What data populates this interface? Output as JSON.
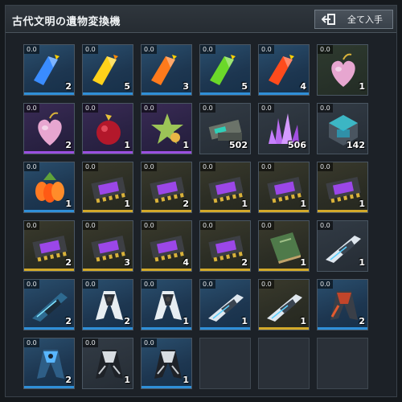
{
  "window": {
    "title": "古代文明の遺物変換機",
    "collect_all_label": "全て入手",
    "collect_icon": "exit-arrow-icon"
  },
  "colors": {
    "common": "#2f8fd8",
    "rare": "#9a4fe0",
    "legendary": "#d2a92a"
  },
  "slots": [
    {
      "time": "0.0",
      "qty": "2",
      "item": "blue-crystal",
      "rarity": "blue"
    },
    {
      "time": "0.0",
      "qty": "5",
      "item": "yellow-crystal",
      "rarity": "blue"
    },
    {
      "time": "0.0",
      "qty": "3",
      "item": "orange-crystal",
      "rarity": "blue"
    },
    {
      "time": "0.0",
      "qty": "5",
      "item": "green-crystal",
      "rarity": "blue"
    },
    {
      "time": "0.0",
      "qty": "4",
      "item": "red-crystal",
      "rarity": "blue"
    },
    {
      "time": "0.0",
      "qty": "1",
      "item": "pink-heart-fruit",
      "rarity": "green"
    },
    {
      "time": "0.0",
      "qty": "2",
      "item": "pink-heart-fruit",
      "rarity": "purple"
    },
    {
      "time": "0.0",
      "qty": "1",
      "item": "red-berry",
      "rarity": "purple"
    },
    {
      "time": "0.0",
      "qty": "1",
      "item": "green-star-fruit",
      "rarity": "purple"
    },
    {
      "time": "0.0",
      "qty": "502",
      "item": "mech-parts",
      "rarity": "dark"
    },
    {
      "time": "0.0",
      "qty": "506",
      "item": "purple-crystal-cluster",
      "rarity": "dark"
    },
    {
      "time": "0.0",
      "qty": "142",
      "item": "cyan-cube",
      "rarity": "dark"
    },
    {
      "time": "0.0",
      "qty": "1",
      "item": "orange-flower",
      "rarity": "blue"
    },
    {
      "time": "0.0",
      "qty": "1",
      "item": "chip",
      "rarity": "gold"
    },
    {
      "time": "0.0",
      "qty": "2",
      "item": "chip",
      "rarity": "gold"
    },
    {
      "time": "0.0",
      "qty": "1",
      "item": "chip",
      "rarity": "gold"
    },
    {
      "time": "0.0",
      "qty": "1",
      "item": "chip",
      "rarity": "gold"
    },
    {
      "time": "0.0",
      "qty": "1",
      "item": "chip",
      "rarity": "gold"
    },
    {
      "time": "0.0",
      "qty": "2",
      "item": "chip",
      "rarity": "gold"
    },
    {
      "time": "0.0",
      "qty": "3",
      "item": "chip",
      "rarity": "gold"
    },
    {
      "time": "0.0",
      "qty": "4",
      "item": "chip",
      "rarity": "gold"
    },
    {
      "time": "0.0",
      "qty": "2",
      "item": "chip",
      "rarity": "gold"
    },
    {
      "time": "0.0",
      "qty": "1",
      "item": "green-book",
      "rarity": "gold"
    },
    {
      "time": "0.0",
      "qty": "1",
      "item": "white-weapon",
      "rarity": "dark"
    },
    {
      "time": "0.0",
      "qty": "2",
      "item": "blue-weapon",
      "rarity": "blue"
    },
    {
      "time": "0.0",
      "qty": "2",
      "item": "white-armor",
      "rarity": "blue"
    },
    {
      "time": "0.0",
      "qty": "1",
      "item": "white-armor",
      "rarity": "blue"
    },
    {
      "time": "0.0",
      "qty": "1",
      "item": "white-weapon",
      "rarity": "blue"
    },
    {
      "time": "0.0",
      "qty": "1",
      "item": "white-weapon",
      "rarity": "gold"
    },
    {
      "time": "0.0",
      "qty": "2",
      "item": "red-armor",
      "rarity": "blue"
    },
    {
      "time": "0.0",
      "qty": "2",
      "item": "blue-armor",
      "rarity": "blue"
    },
    {
      "time": "0.0",
      "qty": "1",
      "item": "dark-armor",
      "rarity": "dark"
    },
    {
      "time": "0.0",
      "qty": "1",
      "item": "dark-armor",
      "rarity": "blue"
    },
    {
      "time": "",
      "qty": "",
      "item": "empty",
      "rarity": "empty"
    },
    {
      "time": "",
      "qty": "",
      "item": "empty",
      "rarity": "empty"
    },
    {
      "time": "",
      "qty": "",
      "item": "empty",
      "rarity": "empty"
    }
  ]
}
